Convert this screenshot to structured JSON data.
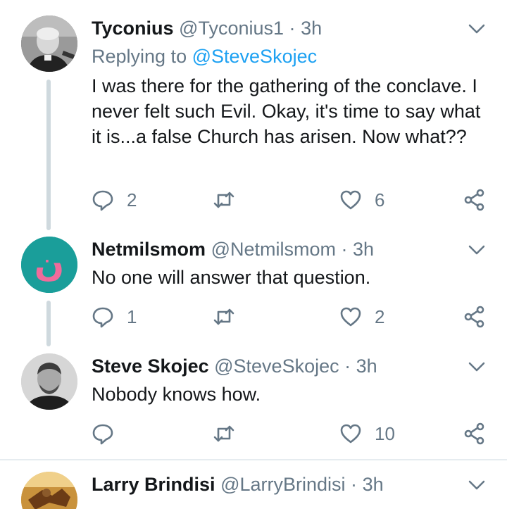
{
  "tweets": [
    {
      "name": "Tyconius",
      "handle": "@Tyconius1",
      "sep": "·",
      "time": "3h",
      "replying_label": "Replying to",
      "replying_to": "@SteveSkojec",
      "body": "I was there for the gathering of the conclave. I never felt such Evil. Okay, it's time to say what it is...a false Church has arisen. Now what??",
      "replies": "2",
      "retweets": "",
      "likes": "6",
      "avatar": "priest-portrait"
    },
    {
      "name": "Netmilsmom",
      "handle": "@Netmilsmom",
      "sep": "·",
      "time": "3h",
      "body": "No one will answer that question.",
      "replies": "1",
      "retweets": "",
      "likes": "2",
      "avatar": "teal-arabic-nun-symbol",
      "avatar_glyph": "ن"
    },
    {
      "name": "Steve Skojec",
      "handle": "@SteveSkojec",
      "sep": "·",
      "time": "3h",
      "body": "Nobody knows how.",
      "replies": "",
      "retweets": "",
      "likes": "10",
      "avatar": "man-portrait"
    },
    {
      "name": "Larry Brindisi",
      "handle": "@LarryBrindisi",
      "sep": "·",
      "time": "3h",
      "avatar": "painting-thumbnail"
    }
  ],
  "colors": {
    "text": "#14171a",
    "secondary": "#657786",
    "link": "#1da1f2",
    "thread": "#cfd9de",
    "nun_bg": "#1a9e9a",
    "nun_glyph": "#f06b9b"
  },
  "icons": [
    "reply-icon",
    "retweet-icon",
    "like-icon",
    "share-icon",
    "chevron-down-icon"
  ]
}
